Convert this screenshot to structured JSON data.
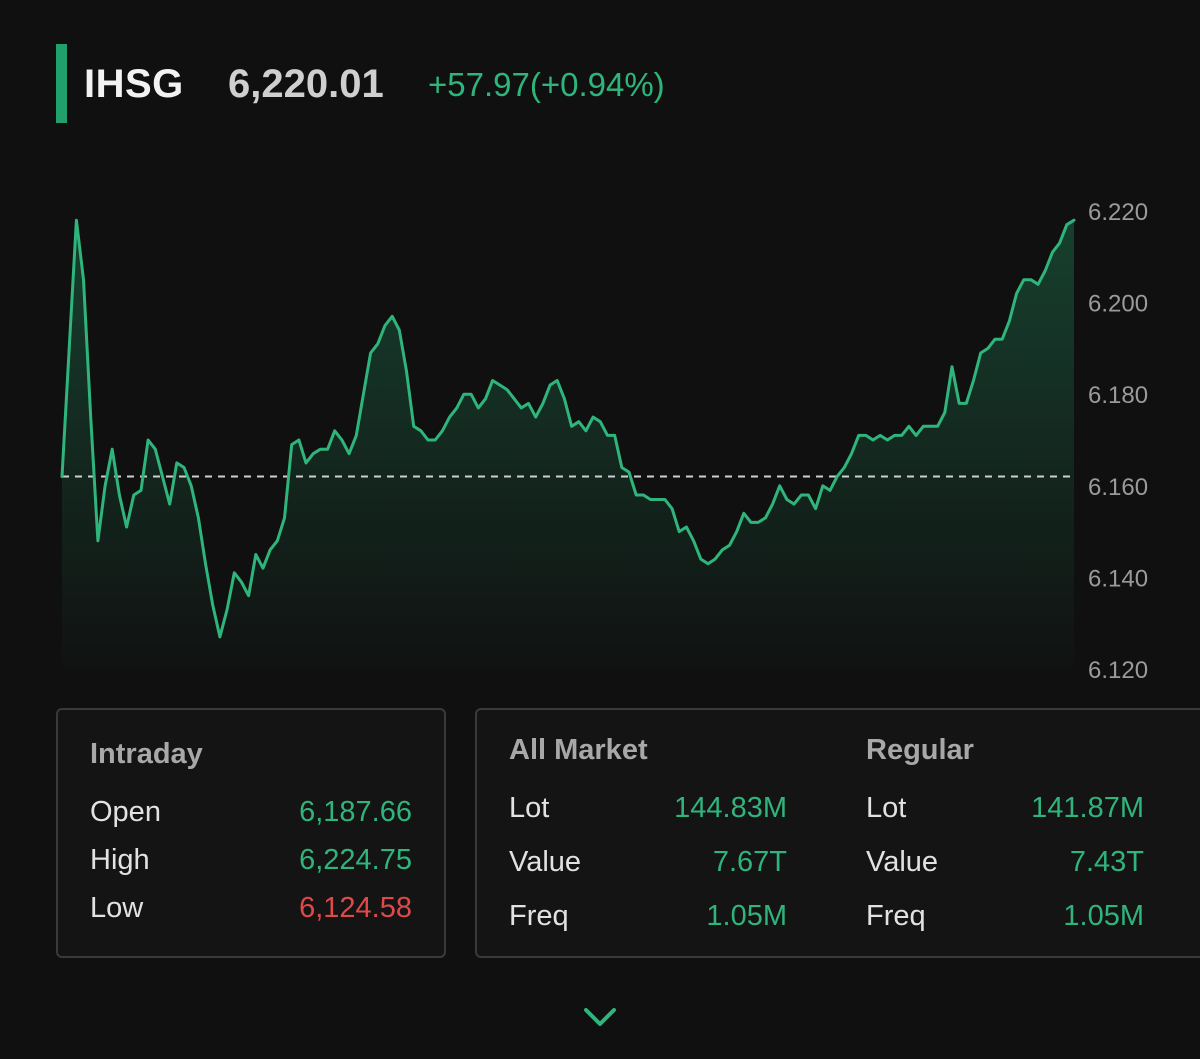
{
  "header": {
    "ticker": "IHSG",
    "price": "6,220.01",
    "change": "+57.97(+0.94%)"
  },
  "colors": {
    "accent": "#22a06b",
    "line": "#2fb57c",
    "negative": "#e0484a",
    "background": "#101010"
  },
  "chart_data": {
    "type": "area",
    "title": "",
    "xlabel": "",
    "ylabel": "",
    "ylim": [
      6120,
      6222
    ],
    "yticks": [
      "6.220",
      "6.200",
      "6.180",
      "6.160",
      "6.140",
      "6.120"
    ],
    "ytick_values": [
      6220,
      6200,
      6180,
      6160,
      6140,
      6120
    ],
    "reference_line": 6162.04,
    "grid": false,
    "series": [
      {
        "values": [
          6162,
          6190,
          6218,
          6205,
          6175,
          6148,
          6160,
          6168,
          6158,
          6151,
          6158,
          6159,
          6170,
          6168,
          6162,
          6156,
          6165,
          6164,
          6160,
          6153,
          6143,
          6134,
          6127,
          6133,
          6141,
          6139,
          6136,
          6145,
          6142,
          6146,
          6148,
          6153,
          6169,
          6170,
          6165,
          6167,
          6168,
          6168,
          6172,
          6170,
          6167,
          6171,
          6180,
          6189,
          6191,
          6195,
          6197,
          6194,
          6185,
          6173,
          6172,
          6170,
          6170,
          6172,
          6175,
          6177,
          6180,
          6180,
          6177,
          6179,
          6183,
          6182,
          6181,
          6179,
          6177,
          6178,
          6175,
          6178,
          6182,
          6183,
          6179,
          6173,
          6174,
          6172,
          6175,
          6174,
          6171,
          6171,
          6164,
          6163,
          6158,
          6158,
          6157,
          6157,
          6157,
          6155,
          6150,
          6151,
          6148,
          6144,
          6143,
          6144,
          6146,
          6147,
          6150,
          6154,
          6152,
          6152,
          6153,
          6156,
          6160,
          6157,
          6156,
          6158,
          6158,
          6155,
          6160,
          6159,
          6162,
          6164,
          6167,
          6171,
          6171,
          6170,
          6171,
          6170,
          6171,
          6171,
          6173,
          6171,
          6173,
          6173,
          6173,
          6176,
          6186,
          6178,
          6178,
          6183,
          6189,
          6190,
          6192,
          6192,
          6196,
          6202,
          6205,
          6205,
          6204,
          6207,
          6211,
          6213,
          6217,
          6218
        ]
      }
    ]
  },
  "intraday": {
    "title": "Intraday",
    "rows": [
      {
        "label": "Open",
        "value": "6,187.66"
      },
      {
        "label": "High",
        "value": "6,224.75"
      },
      {
        "label": "Low",
        "value": "6,124.58"
      }
    ]
  },
  "all_market": {
    "title": "All Market",
    "rows": [
      {
        "label": "Lot",
        "value": "144.83M"
      },
      {
        "label": "Value",
        "value": "7.67T"
      },
      {
        "label": "Freq",
        "value": "1.05M"
      }
    ]
  },
  "regular": {
    "title": "Regular",
    "rows": [
      {
        "label": "Lot",
        "value": "141.87M"
      },
      {
        "label": "Value",
        "value": "7.43T"
      },
      {
        "label": "Freq",
        "value": "1.05M"
      }
    ]
  },
  "icons": {
    "expand": "chevron-down-icon"
  }
}
